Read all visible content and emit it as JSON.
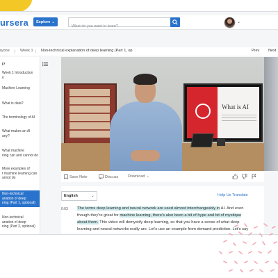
{
  "header": {
    "logo_text": "ursera",
    "explore_label": "Explore",
    "search_placeholder": "What do you want to learn?"
  },
  "breadcrumb": {
    "items": [
      "ryone",
      "Week 1",
      "Non-technical explanation of deep learning (Part 1, op"
    ],
    "separators": [
      "〉",
      "〉"
    ],
    "prev": "Prev",
    "next": "Next"
  },
  "sidebar": {
    "items": [
      {
        "lines": [
          "I?"
        ]
      },
      {
        "lines": [
          "Week 1 Introduction",
          "n"
        ]
      },
      {
        "lines": [
          "Machine Learning"
        ]
      },
      {
        "lines": [
          "What is data?"
        ]
      },
      {
        "lines": [
          "The terminology of AI"
        ]
      },
      {
        "lines": [
          "What makes an AI",
          "any?"
        ]
      },
      {
        "lines": [
          "What machine",
          "ning can and cannot do"
        ]
      },
      {
        "lines": [
          "More examples of",
          "t machine learning can",
          "annot do"
        ]
      },
      {
        "lines": [
          "Non-technical",
          "anation of deep",
          "ning (Part 1, optional)"
        ],
        "active": true
      },
      {
        "lines": [
          "Non-technical",
          "anation of deep",
          "ning (Part 2, optional)"
        ]
      }
    ]
  },
  "video": {
    "screen_title": "What is AI"
  },
  "controls": {
    "save_note": "Save Note",
    "discuss": "Discuss",
    "download": "Download"
  },
  "transcript": {
    "language": "English",
    "help_translate": "Help Us Translate",
    "timestamp": "0:03",
    "lines": [
      [
        {
          "t": "The terms deep learning and neural network are used almost interchangeably in",
          "hl": true
        },
        {
          "t": " AI. And even",
          "hl": false
        }
      ],
      [
        {
          "t": "though they're great for ",
          "hl": false
        },
        {
          "t": "machine learning, there's also been a bit of hype and bit of mystique",
          "hl": true
        }
      ],
      [
        {
          "t": "about them.",
          "hl": true
        },
        {
          "t": " This video will demystify deep learning, so that you have a sense of what deep",
          "hl": false
        }
      ],
      [
        {
          "t": "learning and neural networks really are. Let's use an example from demand prediction. Let's say",
          "hl": false
        }
      ]
    ]
  },
  "colors": {
    "brand_blue": "#2a73cc",
    "highlight": "#cce8ea",
    "deco_yellow": "#f3c826",
    "deco_pink": "#f3a8b4"
  }
}
